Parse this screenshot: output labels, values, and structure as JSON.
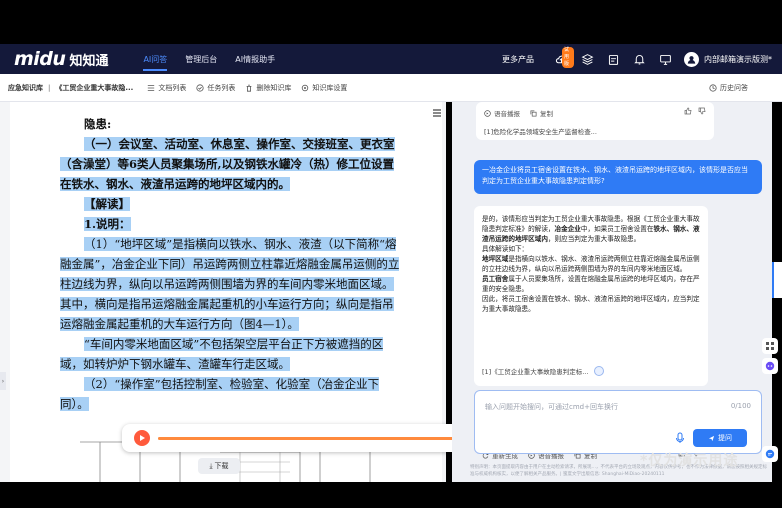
{
  "app": {
    "logo_en": "midu",
    "logo_cn": "知知通"
  },
  "nav": {
    "items": [
      "AI问答",
      "管理后台",
      "AI情报助手"
    ],
    "active_index": 0,
    "more_products": "更多产品",
    "trial_badge": "试用版",
    "username": "内部邮箱演示版测*"
  },
  "subbar": {
    "crumb_root": "应急知识库",
    "crumb_sep": "|",
    "crumb_doc": "《工贸企业重大事故隐...",
    "tools": [
      "文档列表",
      "任务列表",
      "删除知识库",
      "知识库设置"
    ],
    "history": "历史问答"
  },
  "document": {
    "heading": "隐患:",
    "para1": "（一）会议室、活动室、休息室、操作室、交接班室、更衣室（含澡堂）等6类人员聚集场所,以及钢铁水罐冷（热）修工位设置在铁水、钢水、液渣吊运跨的地坪区域内的。",
    "jiedu": "【解读】",
    "shuoming": "1.说明：",
    "para2": "（1）“地坪区域”是指横向以铁水、钢水、液渣（以下简称“熔融金属”，冶金企业下同）吊运跨两侧立柱靠近熔融金属吊运侧的立柱边线为界，纵向以吊运跨两侧围墙为界的车间内零米地面区域。其中，横向是指吊运熔融金属起重机的小车运行方向；纵向是指吊运熔融金属起重机的大车运行方向（图4—1）。",
    "para3": "“车间内零米地面区域”不包括架空层平台正下方被遮挡的区域，如转炉炉下钢水罐车、渣罐车行走区域。",
    "para4": "（2）“操作室”包括控制室、检验室、化验室（冶金企业下同）。"
  },
  "player": {
    "progress": 0.91,
    "download_label": "下载"
  },
  "chat": {
    "prev_actions": [
      "语音播报",
      "复制"
    ],
    "prev_ref": "[1]危险化学品领域安全生产监督检查...",
    "user_question": "一冶金企业将员工宿舍设置在铁水、钢水、液渣吊运跨的地坪区域内，该情形是否应当判定为工贸企业重大事故隐患判定情形?",
    "answer_p1_a": "是的，该情形应当判定为工贸企业重大事故隐患。根据《工贸企业重大事故隐患判定标准》的解读，",
    "answer_p1_b": "冶金企业",
    "answer_p1_c": "中，如果员工宿舍设置在",
    "answer_p1_d": "铁水、钢水、液渣吊运跨的地坪区域内",
    "answer_p1_e": "，则应当判定为重大事故隐患。",
    "answer_basis": "具体解读如下：",
    "answer_p2_b": "地坪区域",
    "answer_p2": "是指横向以铁水、钢水、液渣吊运跨两侧立柱靠近熔融金属吊运侧的立柱边线为界，纵向以吊运跨两侧围墙为界的车间内零米地面区域。",
    "answer_p3_b": "员工宿舍",
    "answer_p3": "属于人员聚集场所，设置在熔融金属吊运跨的地坪区域内，存在严重的安全隐患。",
    "answer_p4": "因此，将员工宿舍设置在铁水、钢水、液渣吊运跨的地坪区域内，应当判定为重大事故隐患。",
    "answer_actions": [
      "重新生成",
      "语音播报",
      "复制"
    ],
    "answer_ref": "[1]《工贸企业重大事故隐患判定标...",
    "input_placeholder": "输入问题开始搜问，可通过cmd+回车换行",
    "input_count": "0/100",
    "send_label": "提问",
    "disclaimer": "特别声明：本页面提取内容由于用户在主动检索请求，所展现…，不代表平台的立场及观点，内容仅供参考，也不作为法律依据，请您按照相关规定标准与权威机构核实，以便了解相关产品服务。| 蜜度文学出版信息: Shanghai-MiDiao-20240111"
  },
  "watermark": "*仅为演示用途",
  "colors": {
    "nav_bg": "#14193a",
    "accent": "#2f7bf5",
    "highlight": "#a8d0f5",
    "play": "#ff5a3c",
    "progress": "#ff8a3d"
  }
}
